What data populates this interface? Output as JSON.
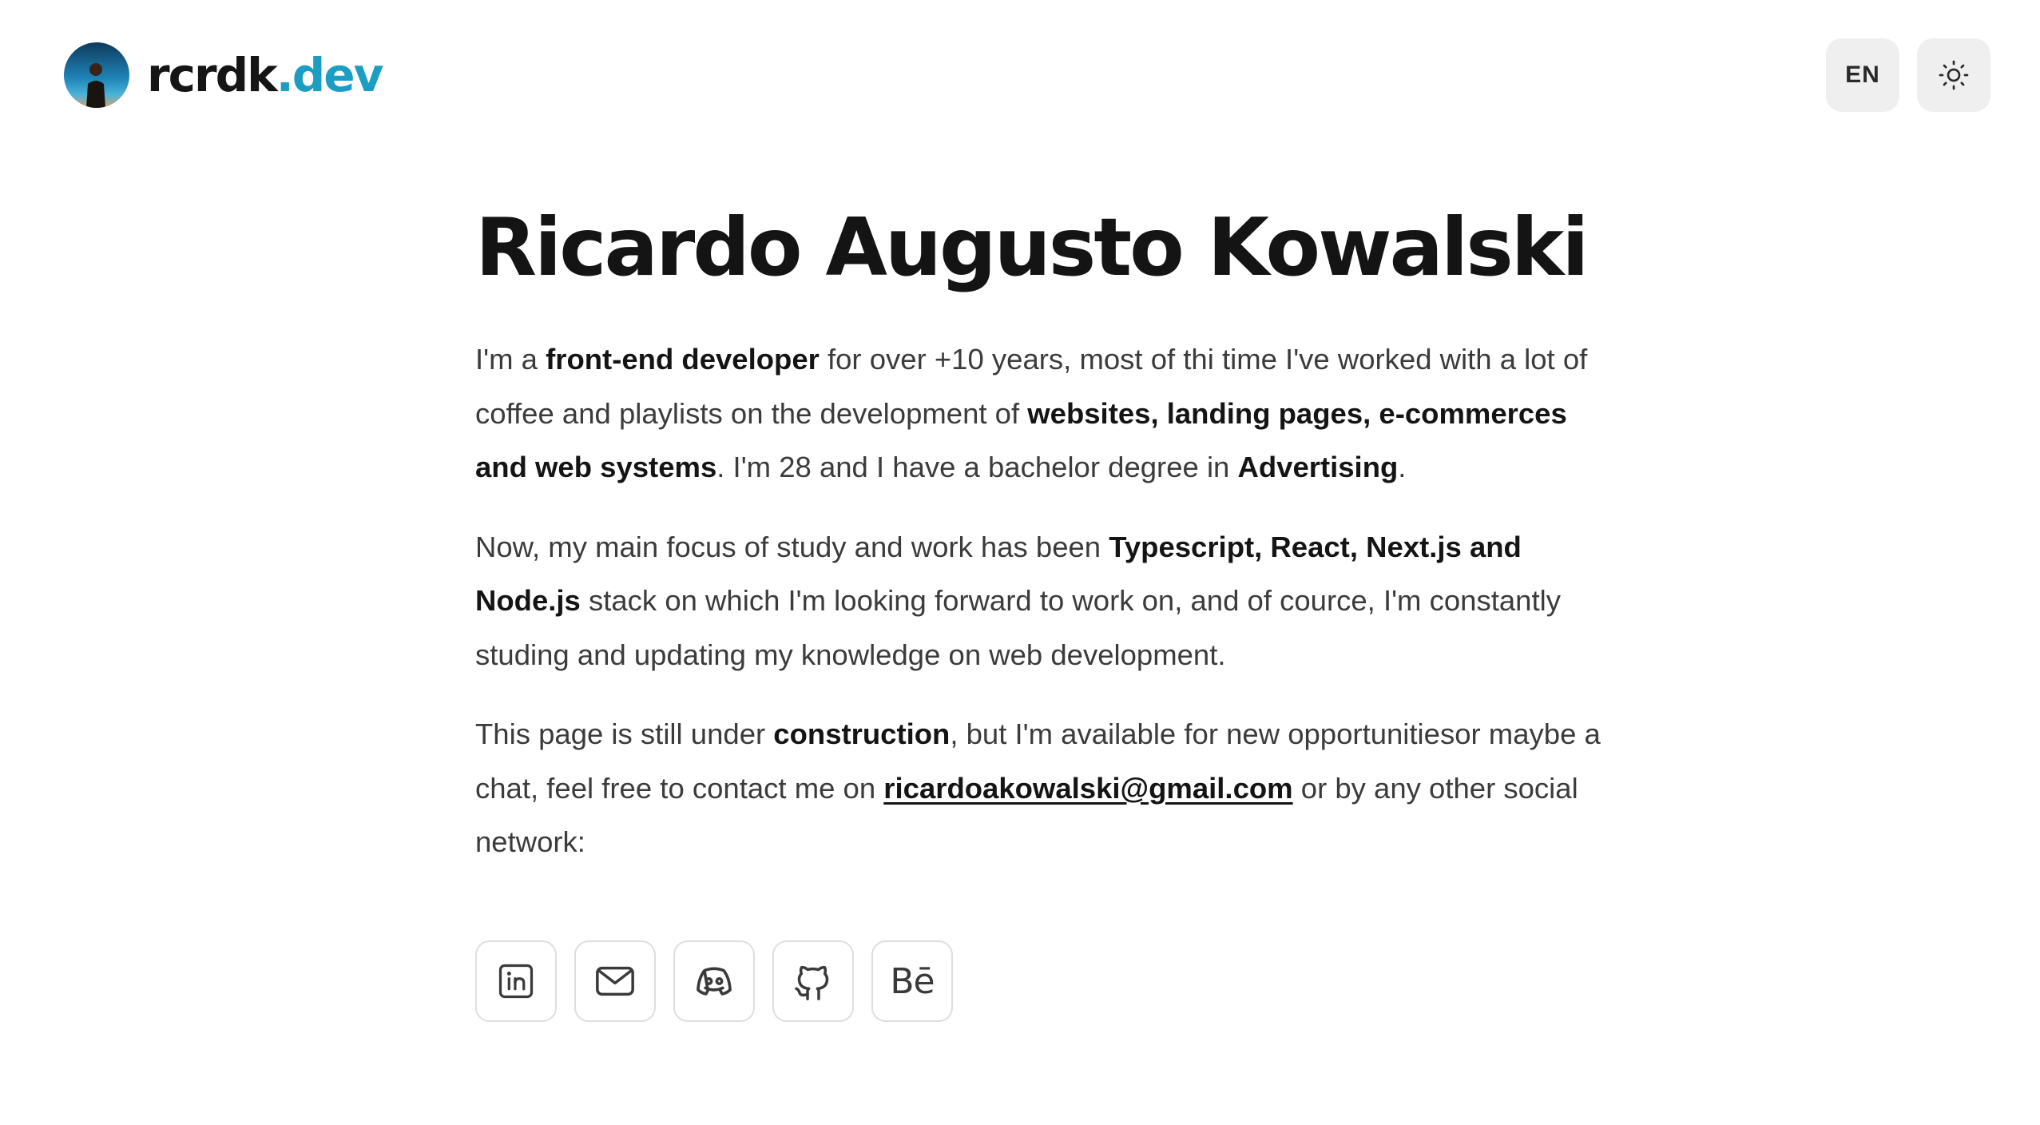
{
  "header": {
    "brand_name": "rcrdk",
    "brand_tld": ".dev",
    "language_label": "EN",
    "theme_icon": "sun-icon",
    "avatar_alt": "avatar"
  },
  "main": {
    "title": "Ricardo Augusto Kowalski",
    "paragraph1": {
      "t1": "I'm a ",
      "b1": "front-end developer",
      "t2": " for over +10 years, most of thi time I've worked with a lot of coffee and playlists on the development of ",
      "b2": "websites, landing pages, e-commerces and web systems",
      "t3": ". I'm 28 and I have a bachelor degree in ",
      "b3": "Advertising",
      "t4": "."
    },
    "paragraph2": {
      "t1": "Now, my main focus of study and work has been ",
      "b1": "Typescript, React, Next.js and Node.js",
      "t2": " stack on which I'm looking forward to work on, and of cource, I'm constantly studing and updating my knowledge on web development."
    },
    "paragraph3": {
      "t1": "This page is still under ",
      "b1": "construction",
      "t2": ", but I'm available for new opportunitiesor maybe a chat, feel free to contact me on ",
      "email": "ricardoakowalski@gmail.com",
      "t3": " or by any other social network:"
    }
  },
  "socials": [
    {
      "icon": "linkedin-icon"
    },
    {
      "icon": "mail-icon"
    },
    {
      "icon": "discord-icon"
    },
    {
      "icon": "github-icon"
    },
    {
      "icon": "behance-icon",
      "label": "Bē"
    }
  ],
  "colors": {
    "accent": "#1b9ec2",
    "text": "#141414",
    "body_text": "#3b3b3b",
    "button_bg": "#efefef",
    "border": "#dedede"
  }
}
